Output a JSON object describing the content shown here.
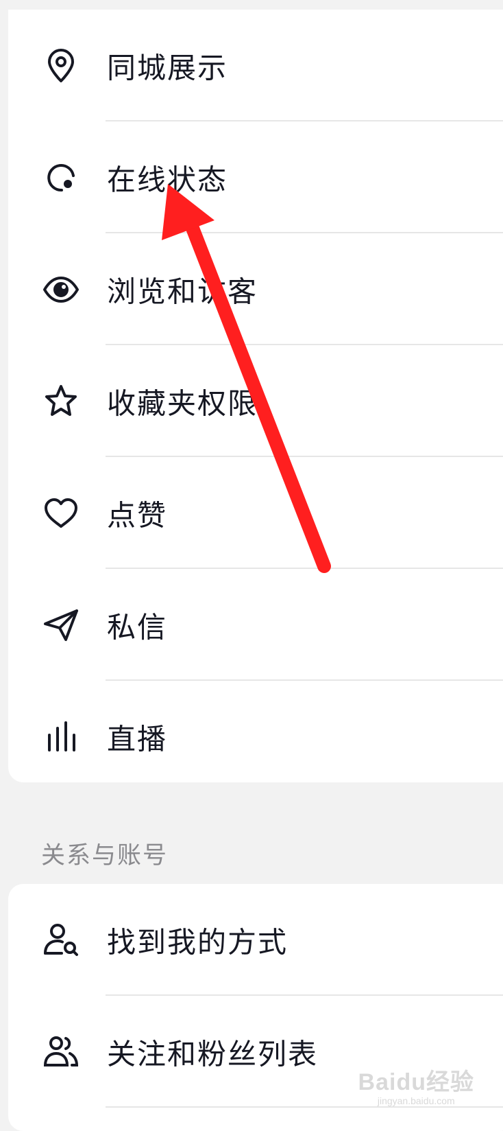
{
  "privacy_items": [
    {
      "label": "同城展示",
      "icon": "location-pin-icon"
    },
    {
      "label": "在线状态",
      "icon": "online-status-icon"
    },
    {
      "label": "浏览和访客",
      "icon": "eye-icon"
    },
    {
      "label": "收藏夹权限",
      "icon": "star-icon"
    },
    {
      "label": "点赞",
      "icon": "heart-icon"
    },
    {
      "label": "私信",
      "icon": "paper-plane-icon"
    },
    {
      "label": "直播",
      "icon": "live-bars-icon"
    }
  ],
  "section_title": "关系与账号",
  "account_items": [
    {
      "label": "找到我的方式",
      "icon": "user-search-icon"
    },
    {
      "label": "关注和粉丝列表",
      "icon": "users-icon"
    }
  ],
  "colors": {
    "background": "#f2f2f2",
    "card": "#ffffff",
    "text": "#161823",
    "annotation_arrow": "#ff1f1f"
  },
  "watermark": {
    "brand": "Baidu经验",
    "url": "jingyan.baidu.com"
  }
}
